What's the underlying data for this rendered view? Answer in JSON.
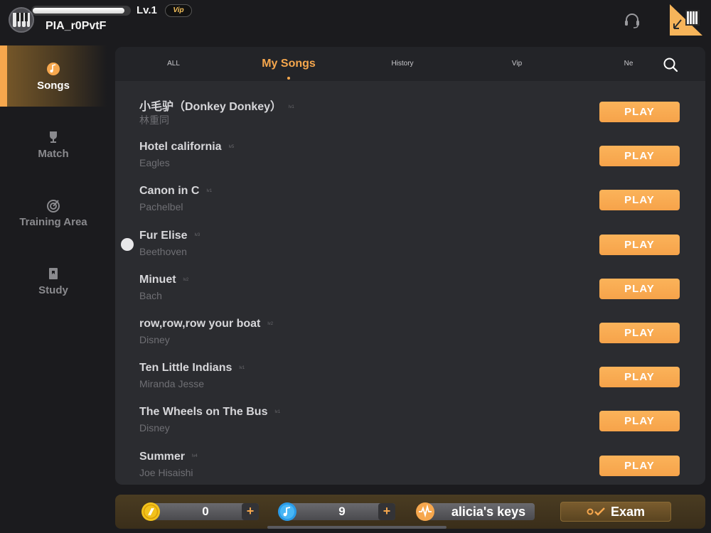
{
  "profile": {
    "level": "Lv.1",
    "vip_badge": "Vip",
    "username": "PIA_r0PvtF",
    "xp_progress": 0.95
  },
  "header": {
    "support_icon": "headset-icon",
    "corner_icon": "piano-keys-collapse-icon"
  },
  "sidebar": {
    "items": [
      {
        "label": "Songs",
        "icon": "music-note-icon",
        "active": true
      },
      {
        "label": "Match",
        "icon": "trophy-icon",
        "active": false
      },
      {
        "label": "Training Area",
        "icon": "target-icon",
        "active": false
      },
      {
        "label": "Study",
        "icon": "book-icon",
        "active": false
      }
    ]
  },
  "tabs": {
    "items": [
      {
        "label": "ALL",
        "active": false
      },
      {
        "label": "My Songs",
        "active": true
      },
      {
        "label": "History",
        "active": false
      },
      {
        "label": "Vip",
        "active": false
      },
      {
        "label": "Ne",
        "active": false
      }
    ],
    "search_icon": "search-icon"
  },
  "songs": [
    {
      "title": "小毛驴（Donkey Donkey）",
      "artist": "林重同",
      "level": "lv1",
      "play_label": "PLAY"
    },
    {
      "title": "Hotel california",
      "artist": "Eagles",
      "level": "lv5",
      "play_label": "PLAY"
    },
    {
      "title": "Canon in C",
      "artist": "Pachelbel",
      "level": "lv1",
      "play_label": "PLAY"
    },
    {
      "title": "Fur Elise",
      "artist": "Beethoven",
      "level": "lv3",
      "play_label": "PLAY"
    },
    {
      "title": "Minuet",
      "artist": "Bach",
      "level": "lv2",
      "play_label": "PLAY"
    },
    {
      "title": "row,row,row your boat",
      "artist": "Disney",
      "level": "lv2",
      "play_label": "PLAY"
    },
    {
      "title": "Ten Little Indians",
      "artist": "Miranda Jesse",
      "level": "lv1",
      "play_label": "PLAY"
    },
    {
      "title": "The Wheels on The Bus",
      "artist": "Disney",
      "level": "lv1",
      "play_label": "PLAY"
    },
    {
      "title": "Summer",
      "artist": "Joe Hisaishi",
      "level": "lv4",
      "play_label": "PLAY"
    }
  ],
  "bottombar": {
    "coins": "0",
    "notes": "9",
    "plus_label": "+",
    "artist": "alicia's keys",
    "exam_label": "Exam",
    "coin_icon": "coin-icon",
    "note_icon": "note-gem-icon",
    "pulse_icon": "waveform-icon",
    "exam_icon": "checkmark-icon"
  },
  "colors": {
    "accent": "#f6a74d",
    "background": "#1b1b1e",
    "panel": "#2b2c30"
  }
}
